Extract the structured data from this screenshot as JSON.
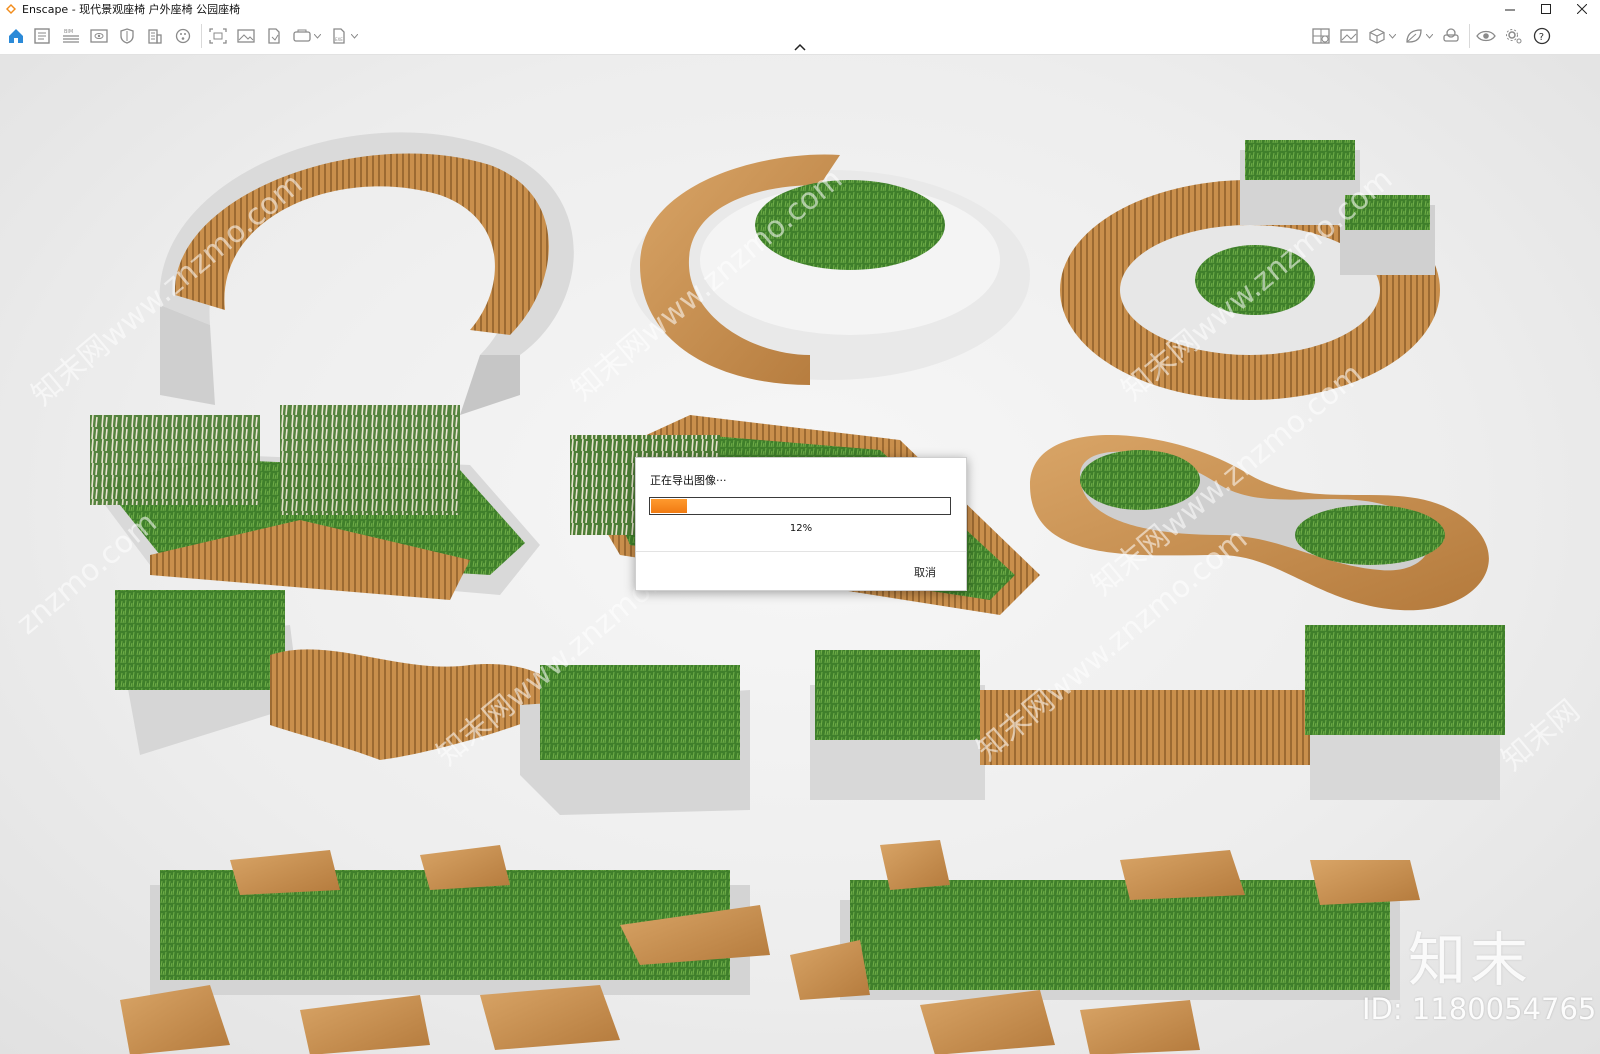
{
  "window": {
    "title": "Enscape - 现代景观座椅 户外座椅 公园座椅",
    "brand_color": "#f28c1b"
  },
  "toolbar": {
    "left_icons": [
      "home-icon",
      "notes-icon",
      "bim-icon",
      "eye-view-icon",
      "shield-icon",
      "building-icon",
      "palette-icon",
      "screenshot-icon",
      "image-icon",
      "file-export-icon",
      "panorama-icon",
      "batch-export-icon"
    ],
    "right_icons": [
      "asset-library-icon",
      "picture-icon",
      "cube-icon",
      "leaf-icon",
      "vr-headset-icon",
      "visibility-icon",
      "settings-icon",
      "help-icon"
    ]
  },
  "dialog": {
    "title": "正在导出图像···",
    "progress": 0.12,
    "percent_label": "12%",
    "cancel_label": "取消",
    "accent_color": "#f07a12"
  },
  "viewport": {
    "watermark_logo": "知末",
    "watermark_id": "ID: 1180054765",
    "watermark_diag": [
      "知末网www.znzmo.com",
      "知末网www.znzmo.com",
      "知末网www.znzmo.com",
      "知末网www.znzmo.com",
      "znzmo.com",
      "知末网www.znzmo.com",
      "知末网www.znzmo.com",
      "知末网"
    ]
  }
}
